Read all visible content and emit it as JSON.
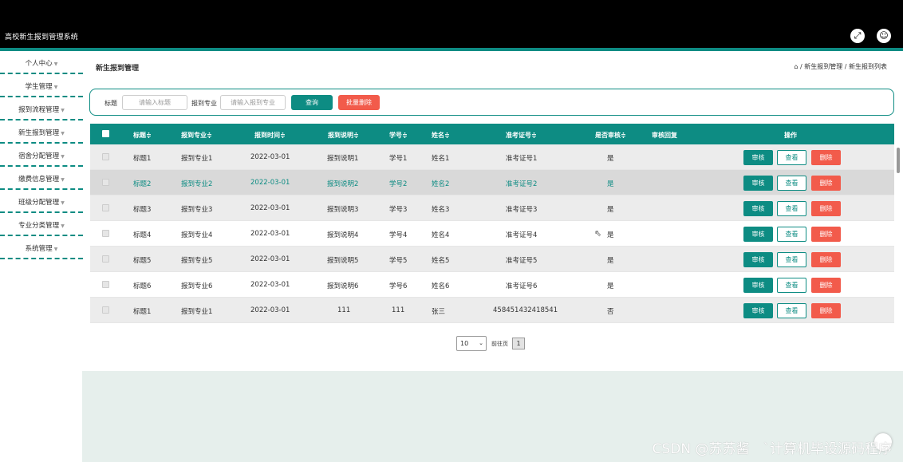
{
  "app": {
    "title": "高校新生报到管理系统",
    "fullscreen_icon": "fullscreen-icon",
    "user_icon": "user-icon"
  },
  "sidebar": {
    "items": [
      {
        "label": "个人中心"
      },
      {
        "label": "学生管理"
      },
      {
        "label": "报到流程管理"
      },
      {
        "label": "新生报到管理"
      },
      {
        "label": "宿舍分配管理"
      },
      {
        "label": "缴费信息管理"
      },
      {
        "label": "班级分配管理"
      },
      {
        "label": "专业分类管理"
      },
      {
        "label": "系统管理"
      }
    ],
    "caret": "▼"
  },
  "page": {
    "title": "新生报到管理",
    "breadcrumb": "⌂ / 新生报到管理 / 新生报到列表"
  },
  "search": {
    "title_label": "标题",
    "title_placeholder": "请输入标题",
    "major_label": "报到专业",
    "major_placeholder": "请输入报到专业",
    "query_button": "查询",
    "bulk_delete_button": "批量删除"
  },
  "table": {
    "headers": {
      "title": "标题≑",
      "major": "报到专业≑",
      "time": "报到时间≑",
      "desc": "报到说明≑",
      "student_no": "学号≑",
      "name": "姓名≑",
      "ticket": "准考证号≑",
      "audited": "是否审核≑",
      "reply": "审核回复",
      "ops": "操作"
    },
    "rows": [
      {
        "title": "标题1",
        "major": "报到专业1",
        "time": "2022-03-01",
        "desc": "报到说明1",
        "student_no": "学号1",
        "name": "姓名1",
        "ticket": "准考证号1",
        "audited": "是",
        "reply": ""
      },
      {
        "title": "标题2",
        "major": "报到专业2",
        "time": "2022-03-01",
        "desc": "报到说明2",
        "student_no": "学号2",
        "name": "姓名2",
        "ticket": "准考证号2",
        "audited": "是",
        "reply": ""
      },
      {
        "title": "标题3",
        "major": "报到专业3",
        "time": "2022-03-01",
        "desc": "报到说明3",
        "student_no": "学号3",
        "name": "姓名3",
        "ticket": "准考证号3",
        "audited": "是",
        "reply": ""
      },
      {
        "title": "标题4",
        "major": "报到专业4",
        "time": "2022-03-01",
        "desc": "报到说明4",
        "student_no": "学号4",
        "name": "姓名4",
        "ticket": "准考证号4",
        "audited": "是",
        "reply": ""
      },
      {
        "title": "标题5",
        "major": "报到专业5",
        "time": "2022-03-01",
        "desc": "报到说明5",
        "student_no": "学号5",
        "name": "姓名5",
        "ticket": "准考证号5",
        "audited": "是",
        "reply": ""
      },
      {
        "title": "标题6",
        "major": "报到专业6",
        "time": "2022-03-01",
        "desc": "报到说明6",
        "student_no": "学号6",
        "name": "姓名6",
        "ticket": "准考证号6",
        "audited": "是",
        "reply": ""
      },
      {
        "title": "标题1",
        "major": "报到专业1",
        "time": "2022-03-01",
        "desc": "111",
        "student_no": "111",
        "name": "张三",
        "ticket": "458451432418541",
        "audited": "否",
        "reply": ""
      }
    ],
    "actions": {
      "audit": "审核",
      "view": "查看",
      "delete": "删除"
    }
  },
  "pagination": {
    "page_size": "10",
    "goto_label": "前往页",
    "current_page": "1"
  },
  "watermark": "CSDN @苏苏酱　`计算机毕设源码程序",
  "colors": {
    "accent": "#0d8c83",
    "danger": "#f25b4b",
    "header": "#000000"
  }
}
